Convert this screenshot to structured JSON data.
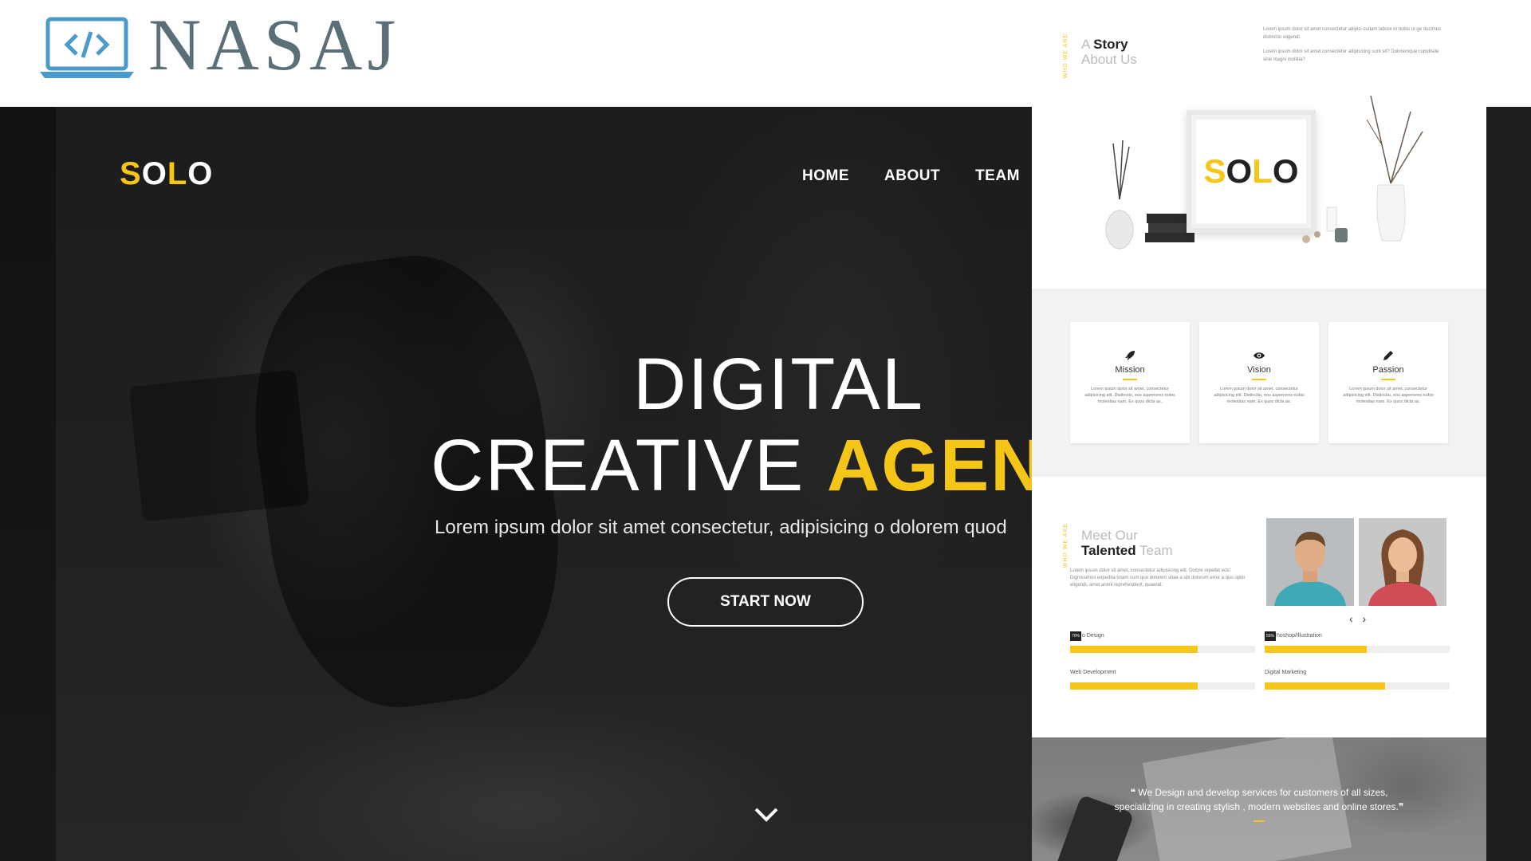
{
  "brand": {
    "name": "NASAJ",
    "logo_icon": "laptop-code-icon",
    "colors": {
      "brand": "#5a6f78",
      "accent": "#4a9bcc"
    }
  },
  "hero": {
    "logo_part1": "S",
    "logo_part2": "O",
    "logo_part3": "L",
    "logo_part4": "O",
    "nav": [
      "HOME",
      "ABOUT",
      "TEAM"
    ],
    "title_line1": "DIGITAL",
    "title_line2_a": "CREATIVE ",
    "title_line2_b": "AGENC",
    "subtitle": "Lorem ipsum dolor sit amet consectetur, adipisicing o dolorem quod",
    "cta": "START NOW",
    "scroll_icon": "chevron-down-icon",
    "accent": "#f5c518"
  },
  "preview": {
    "story": {
      "tag": "WHO WE ARE",
      "title_a": "A ",
      "title_b": "Story",
      "title_c": "About Us",
      "para1": "Lorem ipsum dolor sit amet consectetur adipisi cudam labore in nobis ut ge ducimus distinctio eligendi.",
      "para2": "Lorem ipsum dolor sit amet consectetur adipisicing sunt sit? Doloremque cupiditate sine magni mollitia?"
    },
    "product": {
      "frame_text_1": "S",
      "frame_text_2": "O",
      "frame_text_3": "L",
      "frame_text_4": "O"
    },
    "features": [
      {
        "icon": "rocket-icon",
        "title": "Mission",
        "text": "Lorem ipsum dolor sit amet, consectetur adipisicing elit. Distinctio, eos asperiores nobis molestias nam. Ex quos dicta as."
      },
      {
        "icon": "eye-icon",
        "title": "Vision",
        "text": "Lorem ipsum dolor sit amet, consectetur adipisicing elit. Distinctio, eos asperiores nobis molestias nam. Ex quos dicta as."
      },
      {
        "icon": "pencil-icon",
        "title": "Passion",
        "text": "Lorem ipsum dolor sit amet, consectetur adipisicing elit. Distinctio, eos asperiores nobis molestias nam. Ex quos dicta as."
      }
    ],
    "team": {
      "tag": "WHO WE ARE",
      "title_a": "Meet Our",
      "title_b": "Talented",
      "title_c": " Team",
      "text": "Lorem ipsum dolor sit amet, consectetur adipisicing elit. Dolore repellat eos! Dignissimos expedita totam cum quo dolorem vitae a ubi dolorum error a quo optio eligendi, amet animi reprehenderit, quaerat.",
      "carousel_arrows": "‹ ›",
      "skills": [
        {
          "label": "o Design",
          "pct_label": "70%",
          "level": 0.69
        },
        {
          "label": "hoshop/Illustration",
          "pct_label": "55%",
          "level": 0.55
        },
        {
          "label": "Web Development",
          "pct_label": "",
          "level": 0.69
        },
        {
          "label": "Digital Marketing",
          "pct_label": "",
          "level": 0.65
        }
      ]
    },
    "quote": {
      "open": "❝",
      "text_line1": " We Design and develop services for customers of all sizes,",
      "text_line2": "specializing in creating stylish , modern websites and online stores.",
      "close": "❞"
    }
  }
}
